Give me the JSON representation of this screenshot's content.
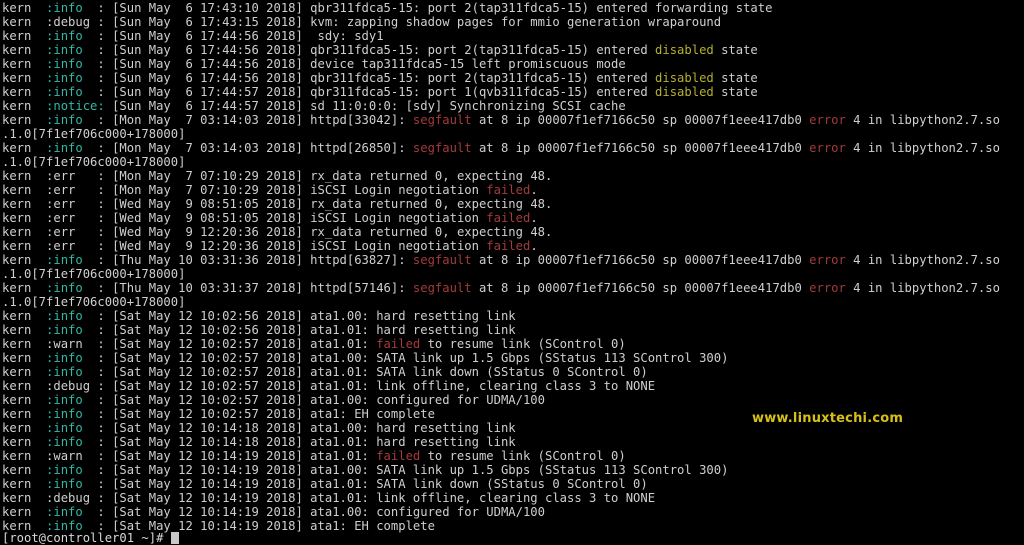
{
  "terminal": {
    "background_color": "#000000",
    "foreground_color": "#cfcfcf",
    "colors": {
      "info": "#2fb8a8",
      "notice": "#2fb8a8",
      "error_red": "#a33a3a",
      "warn_yellow": "#b5b02e",
      "plain": "#cfcfcf"
    },
    "prompt": "[root@controller01 ~]# ",
    "watermark": "www.linuxtechi.com",
    "lines": [
      {
        "segments": [
          {
            "text": "kern  ",
            "color": "plain"
          },
          {
            "text": ":info",
            "color": "info"
          },
          {
            "text": "  : [Sun May  6 17:43:10 2018] qbr311fdca5-15: port 2(tap311fdca5-15) entered forwarding state",
            "color": "plain"
          }
        ]
      },
      {
        "segments": [
          {
            "text": "kern  ",
            "color": "plain"
          },
          {
            "text": ":debug",
            "color": "plain"
          },
          {
            "text": " : [Sun May  6 17:43:15 2018] kvm: zapping shadow pages for mmio generation wraparound",
            "color": "plain"
          }
        ]
      },
      {
        "segments": [
          {
            "text": "kern  ",
            "color": "plain"
          },
          {
            "text": ":info",
            "color": "info"
          },
          {
            "text": "  : [Sun May  6 17:44:56 2018]  sdy: sdy1",
            "color": "plain"
          }
        ]
      },
      {
        "segments": [
          {
            "text": "kern  ",
            "color": "plain"
          },
          {
            "text": ":info",
            "color": "info"
          },
          {
            "text": "  : [Sun May  6 17:44:56 2018] qbr311fdca5-15: port 2(tap311fdca5-15) entered ",
            "color": "plain"
          },
          {
            "text": "disabled",
            "color": "warn_yellow"
          },
          {
            "text": " state",
            "color": "plain"
          }
        ]
      },
      {
        "segments": [
          {
            "text": "kern  ",
            "color": "plain"
          },
          {
            "text": ":info",
            "color": "info"
          },
          {
            "text": "  : [Sun May  6 17:44:56 2018] device tap311fdca5-15 left promiscuous mode",
            "color": "plain"
          }
        ]
      },
      {
        "segments": [
          {
            "text": "kern  ",
            "color": "plain"
          },
          {
            "text": ":info",
            "color": "info"
          },
          {
            "text": "  : [Sun May  6 17:44:56 2018] qbr311fdca5-15: port 2(tap311fdca5-15) entered ",
            "color": "plain"
          },
          {
            "text": "disabled",
            "color": "warn_yellow"
          },
          {
            "text": " state",
            "color": "plain"
          }
        ]
      },
      {
        "segments": [
          {
            "text": "kern  ",
            "color": "plain"
          },
          {
            "text": ":info",
            "color": "info"
          },
          {
            "text": "  : [Sun May  6 17:44:57 2018] qbr311fdca5-15: port 1(qvb311fdca5-15) entered ",
            "color": "plain"
          },
          {
            "text": "disabled",
            "color": "warn_yellow"
          },
          {
            "text": " state",
            "color": "plain"
          }
        ]
      },
      {
        "segments": [
          {
            "text": "kern  ",
            "color": "plain"
          },
          {
            "text": ":notice:",
            "color": "notice"
          },
          {
            "text": " [Sun May  6 17:44:57 2018] sd 11:0:0:0: [sdy] Synchronizing SCSI cache",
            "color": "plain"
          }
        ]
      },
      {
        "segments": [
          {
            "text": "kern  ",
            "color": "plain"
          },
          {
            "text": ":info",
            "color": "info"
          },
          {
            "text": "  : [Mon May  7 03:14:03 2018] httpd[33042]: ",
            "color": "plain"
          },
          {
            "text": "segfault",
            "color": "error_red"
          },
          {
            "text": " at 8 ip 00007f1ef7166c50 sp 00007f1eee417db0 ",
            "color": "plain"
          },
          {
            "text": "error",
            "color": "error_red"
          },
          {
            "text": " 4 in libpython2.7.so",
            "color": "plain"
          }
        ]
      },
      {
        "segments": [
          {
            "text": ".1.0[7f1ef706c000+178000]",
            "color": "plain"
          }
        ]
      },
      {
        "segments": [
          {
            "text": "kern  ",
            "color": "plain"
          },
          {
            "text": ":info",
            "color": "info"
          },
          {
            "text": "  : [Mon May  7 03:14:03 2018] httpd[26850]: ",
            "color": "plain"
          },
          {
            "text": "segfault",
            "color": "error_red"
          },
          {
            "text": " at 8 ip 00007f1ef7166c50 sp 00007f1eee417db0 ",
            "color": "plain"
          },
          {
            "text": "error",
            "color": "error_red"
          },
          {
            "text": " 4 in libpython2.7.so",
            "color": "plain"
          }
        ]
      },
      {
        "segments": [
          {
            "text": ".1.0[7f1ef706c000+178000]",
            "color": "plain"
          }
        ]
      },
      {
        "segments": [
          {
            "text": "kern  ",
            "color": "plain"
          },
          {
            "text": ":err",
            "color": "plain"
          },
          {
            "text": "   : [Mon May  7 07:10:29 2018] rx_data returned 0, expecting 48.",
            "color": "plain"
          }
        ]
      },
      {
        "segments": [
          {
            "text": "kern  ",
            "color": "plain"
          },
          {
            "text": ":err",
            "color": "plain"
          },
          {
            "text": "   : [Mon May  7 07:10:29 2018] iSCSI Login negotiation ",
            "color": "plain"
          },
          {
            "text": "failed",
            "color": "error_red"
          },
          {
            "text": ".",
            "color": "plain"
          }
        ]
      },
      {
        "segments": [
          {
            "text": "kern  ",
            "color": "plain"
          },
          {
            "text": ":err",
            "color": "plain"
          },
          {
            "text": "   : [Wed May  9 08:51:05 2018] rx_data returned 0, expecting 48.",
            "color": "plain"
          }
        ]
      },
      {
        "segments": [
          {
            "text": "kern  ",
            "color": "plain"
          },
          {
            "text": ":err",
            "color": "plain"
          },
          {
            "text": "   : [Wed May  9 08:51:05 2018] iSCSI Login negotiation ",
            "color": "plain"
          },
          {
            "text": "failed",
            "color": "error_red"
          },
          {
            "text": ".",
            "color": "plain"
          }
        ]
      },
      {
        "segments": [
          {
            "text": "kern  ",
            "color": "plain"
          },
          {
            "text": ":err",
            "color": "plain"
          },
          {
            "text": "   : [Wed May  9 12:20:36 2018] rx_data returned 0, expecting 48.",
            "color": "plain"
          }
        ]
      },
      {
        "segments": [
          {
            "text": "kern  ",
            "color": "plain"
          },
          {
            "text": ":err",
            "color": "plain"
          },
          {
            "text": "   : [Wed May  9 12:20:36 2018] iSCSI Login negotiation ",
            "color": "plain"
          },
          {
            "text": "failed",
            "color": "error_red"
          },
          {
            "text": ".",
            "color": "plain"
          }
        ]
      },
      {
        "segments": [
          {
            "text": "kern  ",
            "color": "plain"
          },
          {
            "text": ":info",
            "color": "info"
          },
          {
            "text": "  : [Thu May 10 03:31:36 2018] httpd[63827]: ",
            "color": "plain"
          },
          {
            "text": "segfault",
            "color": "error_red"
          },
          {
            "text": " at 8 ip 00007f1ef7166c50 sp 00007f1eee417db0 ",
            "color": "plain"
          },
          {
            "text": "error",
            "color": "error_red"
          },
          {
            "text": " 4 in libpython2.7.so",
            "color": "plain"
          }
        ]
      },
      {
        "segments": [
          {
            "text": ".1.0[7f1ef706c000+178000]",
            "color": "plain"
          }
        ]
      },
      {
        "segments": [
          {
            "text": "kern  ",
            "color": "plain"
          },
          {
            "text": ":info",
            "color": "info"
          },
          {
            "text": "  : [Thu May 10 03:31:37 2018] httpd[57146]: ",
            "color": "plain"
          },
          {
            "text": "segfault",
            "color": "error_red"
          },
          {
            "text": " at 8 ip 00007f1ef7166c50 sp 00007f1eee417db0 ",
            "color": "plain"
          },
          {
            "text": "error",
            "color": "error_red"
          },
          {
            "text": " 4 in libpython2.7.so",
            "color": "plain"
          }
        ]
      },
      {
        "segments": [
          {
            "text": ".1.0[7f1ef706c000+178000]",
            "color": "plain"
          }
        ]
      },
      {
        "segments": [
          {
            "text": "kern  ",
            "color": "plain"
          },
          {
            "text": ":info",
            "color": "info"
          },
          {
            "text": "  : [Sat May 12 10:02:56 2018] ata1.00: hard resetting link",
            "color": "plain"
          }
        ]
      },
      {
        "segments": [
          {
            "text": "kern  ",
            "color": "plain"
          },
          {
            "text": ":info",
            "color": "info"
          },
          {
            "text": "  : [Sat May 12 10:02:56 2018] ata1.01: hard resetting link",
            "color": "plain"
          }
        ]
      },
      {
        "segments": [
          {
            "text": "kern  ",
            "color": "plain"
          },
          {
            "text": ":warn",
            "color": "plain"
          },
          {
            "text": "  : [Sat May 12 10:02:57 2018] ata1.01: ",
            "color": "plain"
          },
          {
            "text": "failed",
            "color": "error_red"
          },
          {
            "text": " to resume link (SControl 0)",
            "color": "plain"
          }
        ]
      },
      {
        "segments": [
          {
            "text": "kern  ",
            "color": "plain"
          },
          {
            "text": ":info",
            "color": "info"
          },
          {
            "text": "  : [Sat May 12 10:02:57 2018] ata1.00: SATA link up 1.5 Gbps (SStatus 113 SControl 300)",
            "color": "plain"
          }
        ]
      },
      {
        "segments": [
          {
            "text": "kern  ",
            "color": "plain"
          },
          {
            "text": ":info",
            "color": "info"
          },
          {
            "text": "  : [Sat May 12 10:02:57 2018] ata1.01: SATA link down (SStatus 0 SControl 0)",
            "color": "plain"
          }
        ]
      },
      {
        "segments": [
          {
            "text": "kern  ",
            "color": "plain"
          },
          {
            "text": ":debug",
            "color": "plain"
          },
          {
            "text": " : [Sat May 12 10:02:57 2018] ata1.01: link offline, clearing class 3 to NONE",
            "color": "plain"
          }
        ]
      },
      {
        "segments": [
          {
            "text": "kern  ",
            "color": "plain"
          },
          {
            "text": ":info",
            "color": "info"
          },
          {
            "text": "  : [Sat May 12 10:02:57 2018] ata1.00: configured for UDMA/100",
            "color": "plain"
          }
        ]
      },
      {
        "segments": [
          {
            "text": "kern  ",
            "color": "plain"
          },
          {
            "text": ":info",
            "color": "info"
          },
          {
            "text": "  : [Sat May 12 10:02:57 2018] ata1: EH complete",
            "color": "plain"
          }
        ]
      },
      {
        "segments": [
          {
            "text": "kern  ",
            "color": "plain"
          },
          {
            "text": ":info",
            "color": "info"
          },
          {
            "text": "  : [Sat May 12 10:14:18 2018] ata1.00: hard resetting link",
            "color": "plain"
          }
        ]
      },
      {
        "segments": [
          {
            "text": "kern  ",
            "color": "plain"
          },
          {
            "text": ":info",
            "color": "info"
          },
          {
            "text": "  : [Sat May 12 10:14:18 2018] ata1.01: hard resetting link",
            "color": "plain"
          }
        ]
      },
      {
        "segments": [
          {
            "text": "kern  ",
            "color": "plain"
          },
          {
            "text": ":warn",
            "color": "plain"
          },
          {
            "text": "  : [Sat May 12 10:14:19 2018] ata1.01: ",
            "color": "plain"
          },
          {
            "text": "failed",
            "color": "error_red"
          },
          {
            "text": " to resume link (SControl 0)",
            "color": "plain"
          }
        ]
      },
      {
        "segments": [
          {
            "text": "kern  ",
            "color": "plain"
          },
          {
            "text": ":info",
            "color": "info"
          },
          {
            "text": "  : [Sat May 12 10:14:19 2018] ata1.00: SATA link up 1.5 Gbps (SStatus 113 SControl 300)",
            "color": "plain"
          }
        ]
      },
      {
        "segments": [
          {
            "text": "kern  ",
            "color": "plain"
          },
          {
            "text": ":info",
            "color": "info"
          },
          {
            "text": "  : [Sat May 12 10:14:19 2018] ata1.01: SATA link down (SStatus 0 SControl 0)",
            "color": "plain"
          }
        ]
      },
      {
        "segments": [
          {
            "text": "kern  ",
            "color": "plain"
          },
          {
            "text": ":debug",
            "color": "plain"
          },
          {
            "text": " : [Sat May 12 10:14:19 2018] ata1.01: link offline, clearing class 3 to NONE",
            "color": "plain"
          }
        ]
      },
      {
        "segments": [
          {
            "text": "kern  ",
            "color": "plain"
          },
          {
            "text": ":info",
            "color": "info"
          },
          {
            "text": "  : [Sat May 12 10:14:19 2018] ata1.00: configured for UDMA/100",
            "color": "plain"
          }
        ]
      },
      {
        "segments": [
          {
            "text": "kern  ",
            "color": "plain"
          },
          {
            "text": ":info",
            "color": "info"
          },
          {
            "text": "  : [Sat May 12 10:14:19 2018] ata1: EH complete",
            "color": "plain"
          }
        ]
      }
    ]
  }
}
